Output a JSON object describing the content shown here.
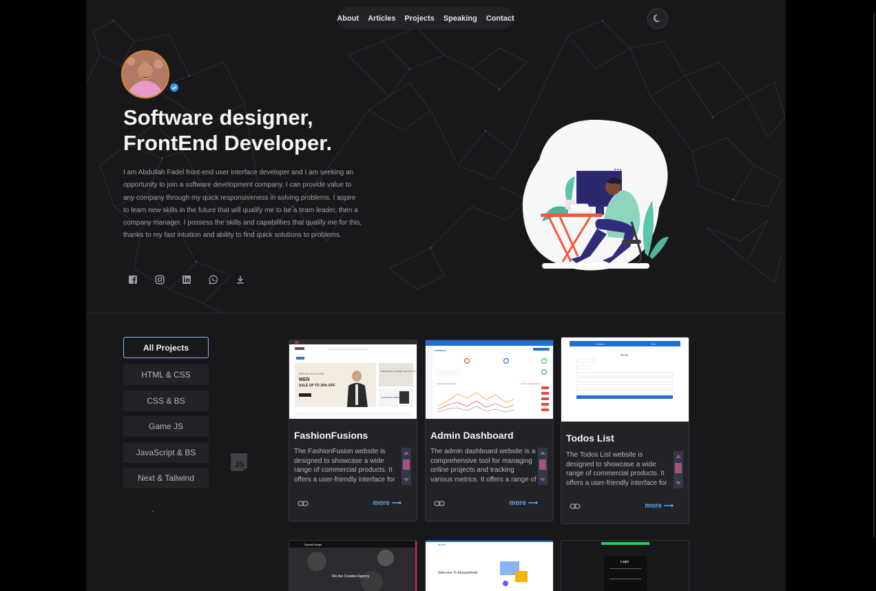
{
  "nav": {
    "items": [
      "About",
      "Articles",
      "Projects",
      "Speaking",
      "Contact"
    ]
  },
  "hero": {
    "headline_line1": "Software designer,",
    "headline_line2": "FrontEnd Developer.",
    "bio": "I am Abdullah Fadel front-end user interface developer and I am seeking an opportunity to join a software development company. I can provide value to any company through my quick responsiveness in solving problems. I aspire to learn new skills in the future that will qualify me to be a team leader, then a company manager. I possess the skills and capabilities that qualify me for this, thanks to my fast intuition and ability to find quick solutions to problems.",
    "socials": [
      "facebook-icon",
      "instagram-icon",
      "linkedin-icon",
      "whatsapp-icon",
      "download-icon"
    ]
  },
  "filters": [
    "All Projects",
    "HTML & CSS",
    "CSS & BS",
    "Game JS",
    "JavaScript & BS",
    "Next & Tailwind"
  ],
  "projects": [
    {
      "title": "FashionFusions",
      "description": "The FashionFusion website is designed to showcase a wide range of commercial products. It offers a user-friendly interface for customers to browse and purchase items easily.",
      "more": "more ⟶",
      "thumb": {
        "banner_small": "UPSTYLE COLLECTION",
        "banner_big": "MEN",
        "banner_sale": "SALE UP TO 30% OFF",
        "side_top": "NEW ARRIVALS SUMMER SALE 20% OFF",
        "side_bottom": "ADVENTURE CAMERA"
      }
    },
    {
      "title": "Admin Dashboard",
      "description": "The admin dashboard website is a comprehensive tool for managing online projects and tracking various metrics. It offers a range of features for administrators.",
      "more": "more ⟶",
      "thumb": {
        "brand": "dashboard",
        "chart_title": "Revenue Generated",
        "side_title": "Recent Transactions"
      }
    },
    {
      "title": "Todos List",
      "description": "The Todos List website is designed to showcase a wide range of commercial products. It offers a user-friendly interface for customers to manage tasks.",
      "more": "more ⟶",
      "thumb": {
        "tab_left": "Todayade",
        "tab_right": "Done",
        "heading": "To do"
      }
    }
  ],
  "bottom_thumbs": {
    "agency_brand": "Spectral Design",
    "agency_title": "We Are Creative Agency",
    "about_brand": "Aboota",
    "about_title": "Welcome To AboutaWorld",
    "login_title": "Login"
  },
  "colors": {
    "page_bg": "#18181b",
    "accent_blue": "#5ea8f0",
    "filter_active_border": "#8ab4f8",
    "avatar_ring": "#d08a2e",
    "scroll_thumb": "#a8527a"
  }
}
